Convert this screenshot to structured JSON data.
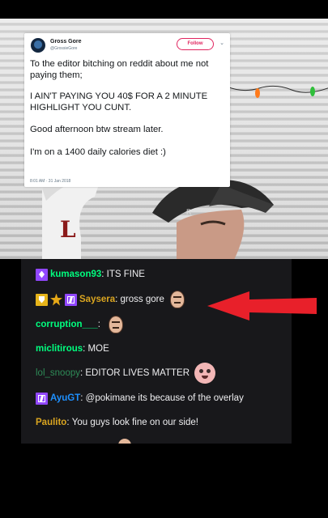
{
  "tweet": {
    "name": "Gross Gore",
    "handle": "@GrossieGore",
    "follow_label": "Follow",
    "caret": "⌄",
    "lines": [
      "To the editor bitching on reddit about me not",
      "paying them;",
      "I AIN'T PAYING YOU 40$ FOR A 2 MINUTE",
      "HIGHLIGHT YOU CUNT.",
      "Good afternoon btw stream later.",
      "I'm on a 1400 daily calories diet :)"
    ],
    "timestamp": "8:01 AM · 31 Jan 2018"
  },
  "stocking_letter": "L",
  "chat": {
    "messages": [
      {
        "user": "kumason93",
        "text": "ITS FINE",
        "color": "#00ff7f",
        "badges": [
          "sub-badge"
        ]
      },
      {
        "user": "Saysera",
        "text": "gross gore",
        "color": "#daa520",
        "badges": [
          "shield-badge",
          "star-badge",
          "prime-badge"
        ],
        "emote": "face-emote"
      },
      {
        "user": "corruption___",
        "text": "",
        "color": "#00ff7f",
        "badges": [],
        "emote": "face-emote"
      },
      {
        "user": "miclitirous",
        "text": "MOE",
        "color": "#00ff7f",
        "badges": []
      },
      {
        "user": "lol_snoopy",
        "text": "EDITOR LIVES MATTER",
        "color": "#2e8b57",
        "badges": [],
        "emote": "cry-emote"
      },
      {
        "user": "AyuGT",
        "text": "@pokimane its because of the overlay",
        "color": "#1e90ff",
        "badges": [
          "prime-badge"
        ]
      },
      {
        "user": "Paulito",
        "text": "You guys look fine on our side!",
        "color": "#daa520",
        "badges": []
      }
    ]
  },
  "colors": {
    "arrow": "#e8202a",
    "chat_bg": "#18181b"
  }
}
